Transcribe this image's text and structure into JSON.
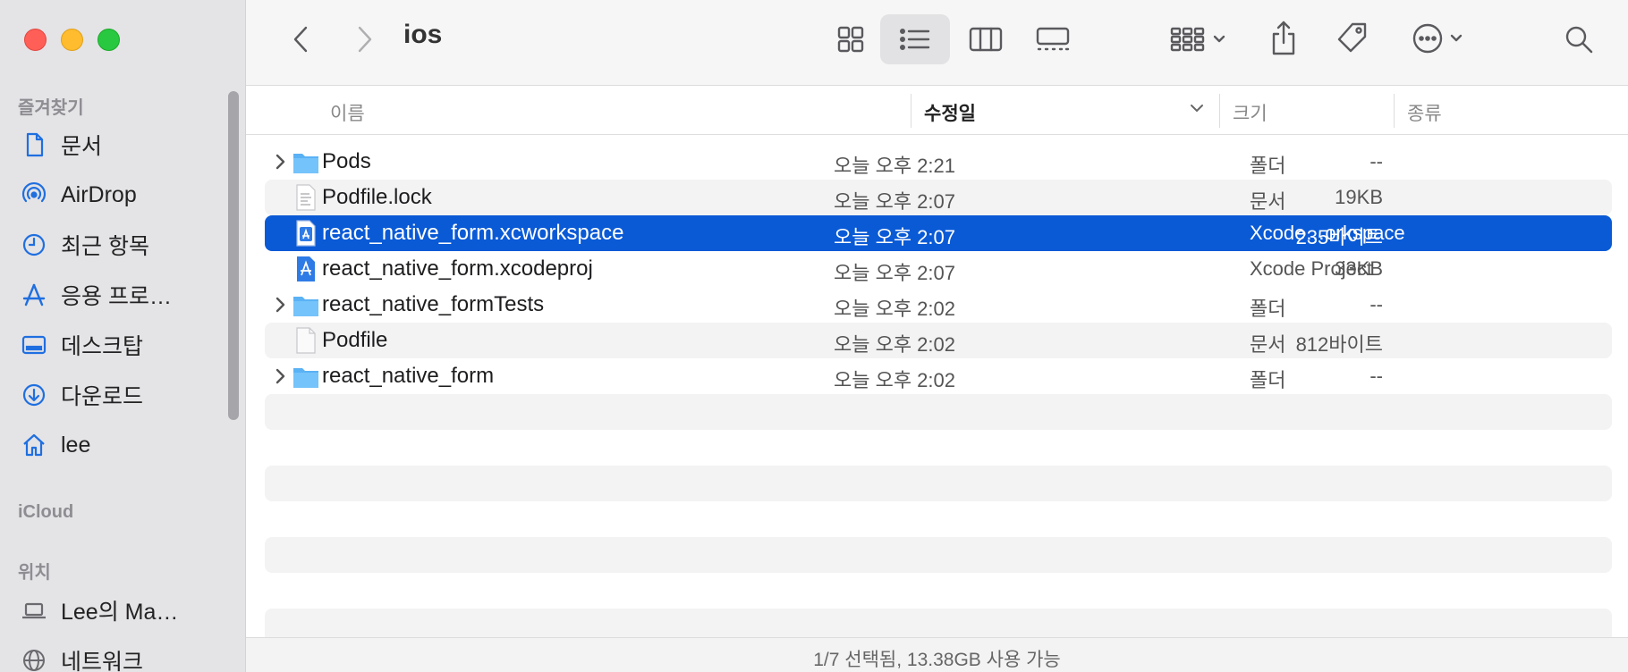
{
  "window": {
    "title": "ios"
  },
  "sidebar": {
    "favorites_label": "즐겨찾기",
    "favorites": [
      {
        "label": "문서",
        "icon": "document-icon"
      },
      {
        "label": "AirDrop",
        "icon": "airdrop-icon"
      },
      {
        "label": "최근 항목",
        "icon": "clock-icon"
      },
      {
        "label": "응용 프로…",
        "icon": "applications-icon"
      },
      {
        "label": "데스크탑",
        "icon": "desktop-icon"
      },
      {
        "label": "다운로드",
        "icon": "download-icon"
      },
      {
        "label": "lee",
        "icon": "home-icon"
      }
    ],
    "icloud_label": "iCloud",
    "locations_label": "위치",
    "locations": [
      {
        "label": "Lee의 Ma…",
        "icon": "laptop-icon"
      },
      {
        "label": "네트워크",
        "icon": "network-icon"
      }
    ]
  },
  "columns": {
    "name": "이름",
    "date": "수정일",
    "size": "크기",
    "kind": "종류"
  },
  "files": [
    {
      "name": "Pods",
      "date": "오늘 오후 2:21",
      "size": "--",
      "kind": "폴더",
      "type": "folder",
      "expandable": true,
      "selected": false
    },
    {
      "name": "Podfile.lock",
      "date": "오늘 오후 2:07",
      "size": "19KB",
      "kind": "문서",
      "type": "text",
      "expandable": false,
      "selected": false
    },
    {
      "name": "react_native_form.xcworkspace",
      "date": "오늘 오후 2:07",
      "size": "235바이트",
      "kind": "Xcode…orkspace",
      "type": "xcode",
      "expandable": false,
      "selected": true
    },
    {
      "name": "react_native_form.xcodeproj",
      "date": "오늘 오후 2:07",
      "size": "33KB",
      "kind": "Xcode Project",
      "type": "xcode",
      "expandable": false,
      "selected": false
    },
    {
      "name": "react_native_formTests",
      "date": "오늘 오후 2:02",
      "size": "--",
      "kind": "폴더",
      "type": "folder",
      "expandable": true,
      "selected": false
    },
    {
      "name": "Podfile",
      "date": "오늘 오후 2:02",
      "size": "812바이트",
      "kind": "문서",
      "type": "blank",
      "expandable": false,
      "selected": false
    },
    {
      "name": "react_native_form",
      "date": "오늘 오후 2:02",
      "size": "--",
      "kind": "폴더",
      "type": "folder",
      "expandable": true,
      "selected": false
    }
  ],
  "status": {
    "text": "1/7 선택됨, 13.38GB 사용 가능"
  },
  "colors": {
    "selection": "#0a5ad6",
    "folder": "#5ab2f5",
    "sidebar_icon": "#1f6fe0"
  }
}
